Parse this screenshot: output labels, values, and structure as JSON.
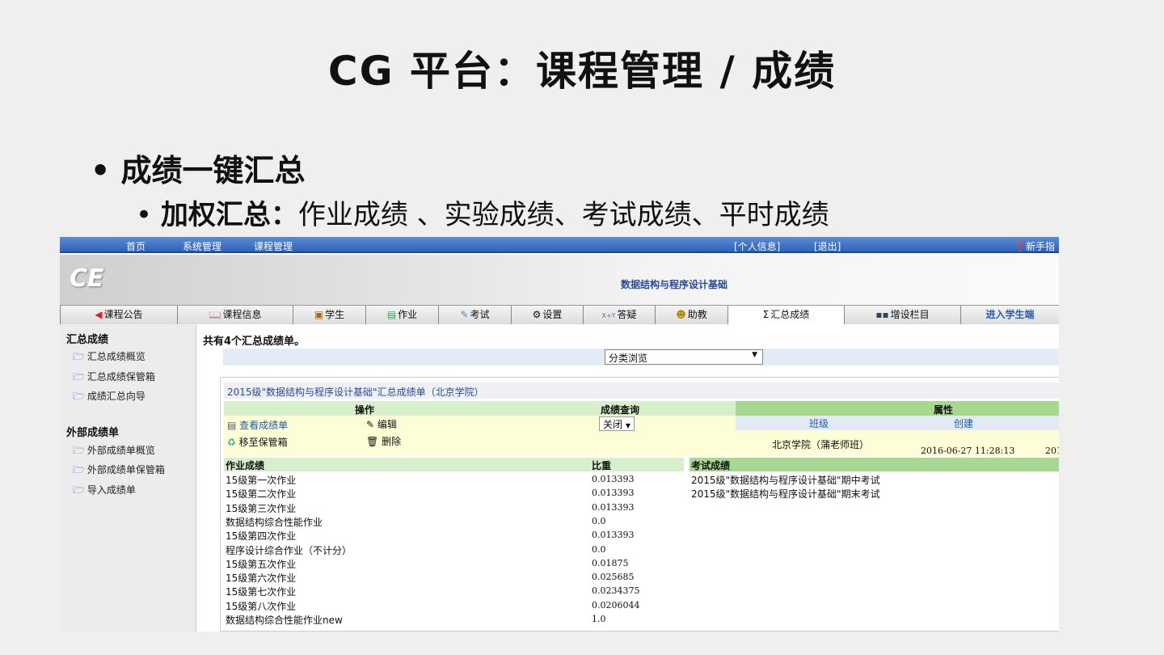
{
  "slide": {
    "title": "CG 平台：课程管理  /  成绩",
    "bullet1": "成绩一键汇总",
    "bullet2_bold": "加权汇总：",
    "bullet2_rest": "作业成绩 、实验成绩、考试成绩、平时成绩"
  },
  "topnav": {
    "items": [
      "首页",
      "系统管理",
      "课程管理"
    ],
    "profile": "[个人信息]",
    "logout": "[退出]",
    "guide": "新手指南"
  },
  "banner": {
    "course": "数据结构与程序设计基础"
  },
  "tabs": [
    {
      "label": "课程公告",
      "icon": "speaker-icon"
    },
    {
      "label": "课程信息",
      "icon": "book-icon"
    },
    {
      "label": "学生",
      "icon": "students-icon"
    },
    {
      "label": "作业",
      "icon": "books-icon"
    },
    {
      "label": "考试",
      "icon": "pen-icon"
    },
    {
      "label": "设置",
      "icon": "gear-icon"
    },
    {
      "label": "答疑",
      "icon": "xy-icon"
    },
    {
      "label": "助教",
      "icon": "person-icon"
    },
    {
      "label": "汇总成绩",
      "icon": "sigma-icon"
    },
    {
      "label": "增设栏目",
      "icon": "grid-icon"
    },
    {
      "label": "进入学生端"
    }
  ],
  "sidebar": {
    "section1": "汇总成绩",
    "items1": [
      "汇总成绩概览",
      "汇总成绩保管箱",
      "成绩汇总向导"
    ],
    "section2": "外部成绩单",
    "items2": [
      "外部成绩单概览",
      "外部成绩单保管箱",
      "导入成绩单"
    ]
  },
  "main": {
    "count": "共有4个汇总成绩单。",
    "filter": "分类浏览",
    "card": {
      "title": "2015级\"数据结构与程序设计基础\"汇总成绩单（北京学院）",
      "ops_header": "操作",
      "query_header": "成绩查询",
      "attr_header": "属性",
      "view": "查看成绩单",
      "edit": "编辑",
      "move": "移至保管箱",
      "delete": "删除",
      "query_value": "关闭",
      "class_header": "班级",
      "created_header": "创建",
      "class_value": "北京学院（蒲老师班）",
      "created_value": "2016-06-27 11:28:13",
      "created_cut": "201",
      "hw_header": "作业成绩",
      "weight_header": "比重",
      "exam_header": "考试成绩",
      "homework": [
        {
          "name": "15级第一次作业",
          "w": "0.013393"
        },
        {
          "name": "15级第二次作业",
          "w": "0.013393"
        },
        {
          "name": "15级第三次作业",
          "w": "0.013393"
        },
        {
          "name": "数据结构综合性能作业",
          "w": "0.0"
        },
        {
          "name": "15级第四次作业",
          "w": "0.013393"
        },
        {
          "name": "程序设计综合作业（不计分）",
          "w": "0.0"
        },
        {
          "name": "15级第五次作业",
          "w": "0.01875"
        },
        {
          "name": "15级第六次作业",
          "w": "0.025685"
        },
        {
          "name": "15级第七次作业",
          "w": "0.0234375"
        },
        {
          "name": "15级第八次作业",
          "w": "0.0206044"
        },
        {
          "name": "数据结构综合性能作业new",
          "w": "1.0"
        }
      ],
      "exams": [
        "2015级\"数据结构与程序设计基础\"期中考试",
        "2015级\"数据结构与程序设计基础\"期末考试"
      ]
    }
  }
}
